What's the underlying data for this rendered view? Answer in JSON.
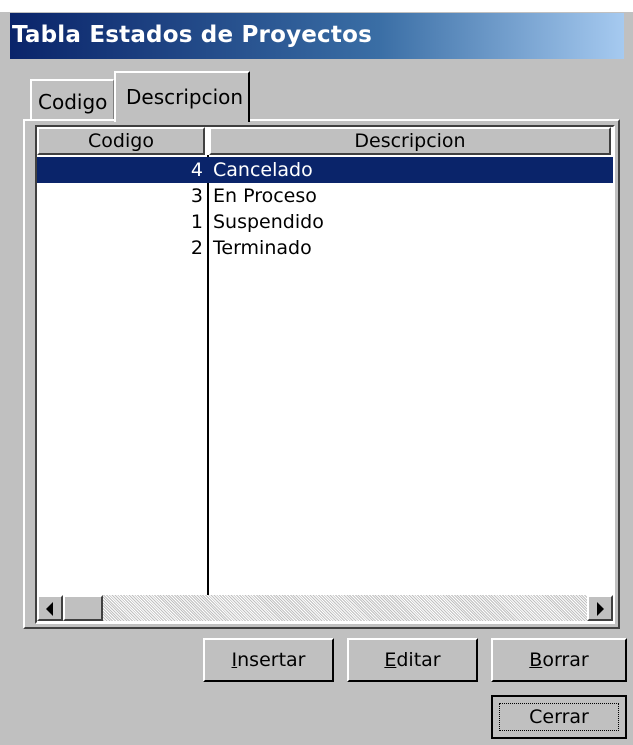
{
  "window": {
    "title": "Tabla Estados de Proyectos"
  },
  "tabs": [
    {
      "label": "Codigo",
      "active": false
    },
    {
      "label": "Descripcion",
      "active": true
    }
  ],
  "grid": {
    "columns": [
      "Codigo",
      "Descripcion"
    ],
    "rows": [
      {
        "codigo": "4",
        "descripcion": "Cancelado",
        "selected": true
      },
      {
        "codigo": "3",
        "descripcion": "En Proceso",
        "selected": false
      },
      {
        "codigo": "1",
        "descripcion": "Suspendido",
        "selected": false
      },
      {
        "codigo": "2",
        "descripcion": "Terminado",
        "selected": false
      }
    ]
  },
  "buttons": {
    "insertar": {
      "mnemonic": "I",
      "rest": "nsertar"
    },
    "editar": {
      "mnemonic": "E",
      "rest": "ditar"
    },
    "borrar": {
      "mnemonic": "B",
      "rest": "orrar"
    },
    "cerrar": "Cerrar"
  },
  "colors": {
    "selection": "#0a246a",
    "titlebar_start": "#0a246a",
    "face": "#c0c0c0"
  }
}
